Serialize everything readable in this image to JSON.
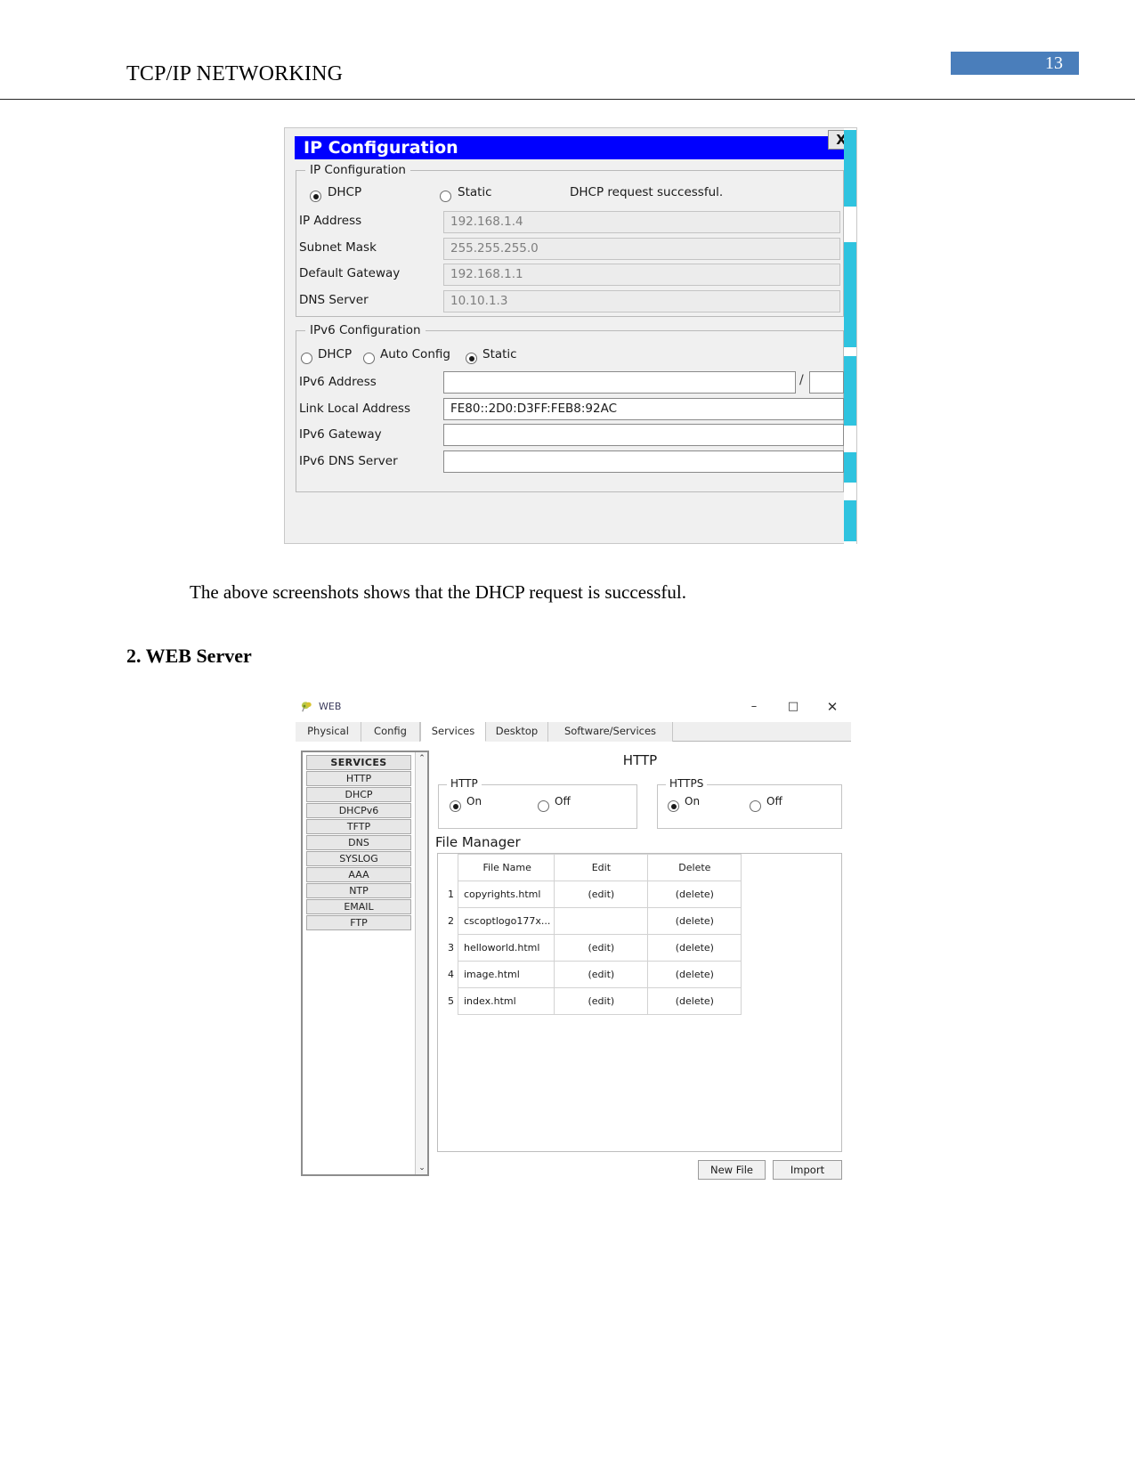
{
  "document": {
    "running_head": "TCP/IP NETWORKING",
    "page_number": "13",
    "accent_color": "#4a7ebb",
    "caption": "The above screenshots shows that the DHCP request is successful.",
    "section_heading": "2. WEB Server"
  },
  "ip_config_window": {
    "title": "IP Configuration",
    "close_label": "X",
    "ipv4_group": {
      "legend": "IP Configuration",
      "mode_options": [
        {
          "label": "DHCP",
          "selected": true
        },
        {
          "label": "Static",
          "selected": false
        }
      ],
      "status_message": "DHCP request successful.",
      "fields": [
        {
          "label": "IP Address",
          "value": "192.168.1.4"
        },
        {
          "label": "Subnet Mask",
          "value": "255.255.255.0"
        },
        {
          "label": "Default Gateway",
          "value": "192.168.1.1"
        },
        {
          "label": "DNS Server",
          "value": "10.10.1.3"
        }
      ]
    },
    "ipv6_group": {
      "legend": "IPv6 Configuration",
      "mode_options": [
        {
          "label": "DHCP",
          "selected": false
        },
        {
          "label": "Auto Config",
          "selected": false
        },
        {
          "label": "Static",
          "selected": true
        }
      ],
      "prefix_separator": "/",
      "fields": [
        {
          "label": "IPv6 Address",
          "value": ""
        },
        {
          "label": "Link Local Address",
          "value": "FE80::2D0:D3FF:FEB8:92AC"
        },
        {
          "label": "IPv6 Gateway",
          "value": ""
        },
        {
          "label": "IPv6 DNS Server",
          "value": ""
        }
      ],
      "prefix_length": ""
    }
  },
  "web_window": {
    "title": "WEB",
    "window_buttons": {
      "minimize": "–",
      "maximize": "□",
      "close": "✕"
    },
    "tabs": [
      {
        "label": "Physical",
        "active": false
      },
      {
        "label": "Config",
        "active": false
      },
      {
        "label": "Services",
        "active": true
      },
      {
        "label": "Desktop",
        "active": false
      },
      {
        "label": "Software/Services",
        "active": false
      }
    ],
    "services_panel": {
      "header": "SERVICES",
      "items": [
        "HTTP",
        "DHCP",
        "DHCPv6",
        "TFTP",
        "DNS",
        "SYSLOG",
        "AAA",
        "NTP",
        "EMAIL",
        "FTP"
      ],
      "scroll_up": "⌃",
      "scroll_down": "⌄"
    },
    "pane": {
      "title": "HTTP",
      "http_group": {
        "legend": "HTTP",
        "options": [
          {
            "label": "On",
            "selected": true
          },
          {
            "label": "Off",
            "selected": false
          }
        ]
      },
      "https_group": {
        "legend": "HTTPS",
        "options": [
          {
            "label": "On",
            "selected": true
          },
          {
            "label": "Off",
            "selected": false
          }
        ]
      },
      "file_manager": {
        "title": "File Manager",
        "columns": [
          "File Name",
          "Edit",
          "Delete"
        ],
        "rows": [
          {
            "index": "1",
            "file_name": "copyrights.html",
            "edit": "(edit)",
            "delete": "(delete)"
          },
          {
            "index": "2",
            "file_name": "cscoptlogo177x...",
            "edit": "",
            "delete": "(delete)"
          },
          {
            "index": "3",
            "file_name": "helloworld.html",
            "edit": "(edit)",
            "delete": "(delete)"
          },
          {
            "index": "4",
            "file_name": "image.html",
            "edit": "(edit)",
            "delete": "(delete)"
          },
          {
            "index": "5",
            "file_name": "index.html",
            "edit": "(edit)",
            "delete": "(delete)"
          }
        ],
        "new_file_label": "New File",
        "import_label": "Import"
      }
    }
  }
}
